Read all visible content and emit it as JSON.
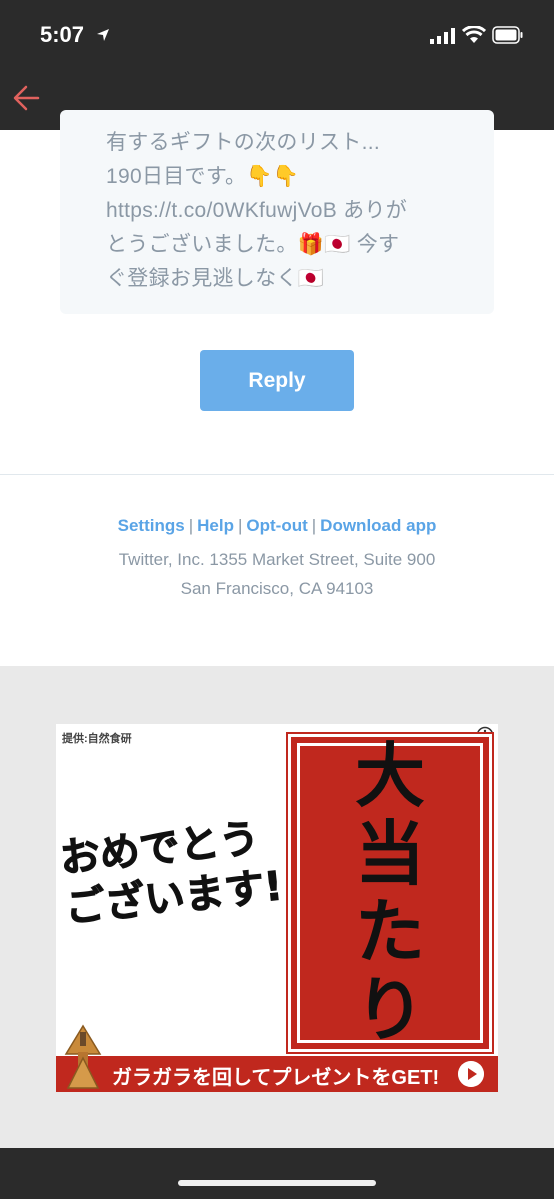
{
  "status_bar": {
    "time": "5:07"
  },
  "message": {
    "lines": [
      "有するギフトの次のリスト...",
      "190日目です。👇👇",
      "https://t.co/0WKfuwjVoB ありが",
      "とうございました。🎁🇯🇵 今す",
      "ぐ登録お見逃しなく🇯🇵"
    ]
  },
  "reply_button": {
    "label": "Reply"
  },
  "footer": {
    "links": [
      "Settings",
      "Help",
      "Opt-out",
      "Download app"
    ],
    "separator": "|",
    "address_line1": "Twitter, Inc. 1355 Market Street, Suite 900",
    "address_line2": "San Francisco, CA 94103"
  },
  "ad": {
    "provider": "提供:自然食研",
    "headline_line1": "おめでとう",
    "headline_line2": "ございます!",
    "vertical_text": [
      "大",
      "当",
      "た",
      "り"
    ],
    "banner_text": "ガラガラを回してプレゼントをGET!"
  },
  "colors": {
    "chrome": "#2b2b2b",
    "accent_back_arrow": "#e0625e",
    "reply_button": "#6aaeea",
    "link": "#5aa4e6",
    "muted_text": "#8b98a5",
    "ad_red": "#c0281e"
  }
}
